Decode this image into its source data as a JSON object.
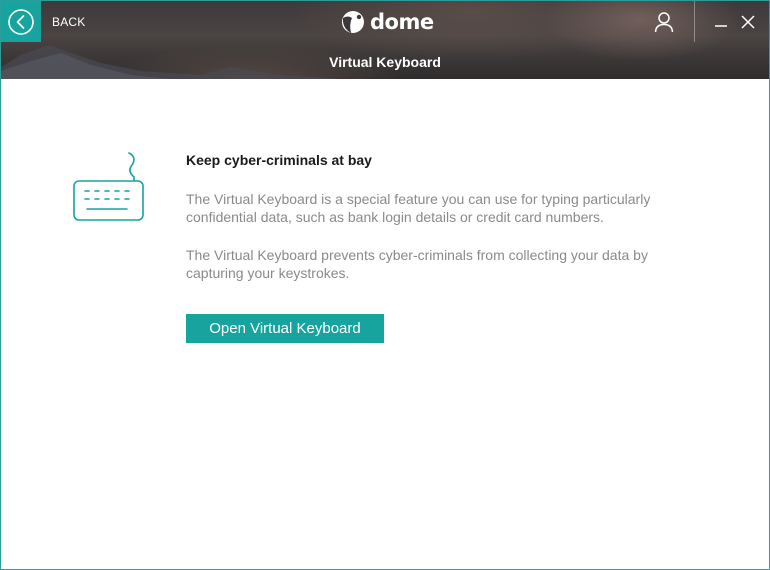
{
  "header": {
    "back_label": "BACK",
    "logo_text": "dome",
    "page_title": "Virtual Keyboard"
  },
  "main": {
    "heading": "Keep cyber-criminals at bay",
    "paragraphs": [
      "The Virtual Keyboard is a special feature you can use for typing particularly confidential data, such as bank login details or credit card numbers.",
      "The Virtual Keyboard prevents cyber-criminals from collecting your data by capturing your keystrokes."
    ],
    "open_button_label": "Open Virtual Keyboard"
  },
  "icons": {
    "back": "chevron-left-icon",
    "user": "user-icon",
    "minimize": "minimize-icon",
    "close": "close-icon",
    "illustration": "keyboard-icon"
  },
  "colors": {
    "accent": "#17a39e",
    "heading_text": "#1a1a1a",
    "body_text": "#8a8a8a"
  }
}
